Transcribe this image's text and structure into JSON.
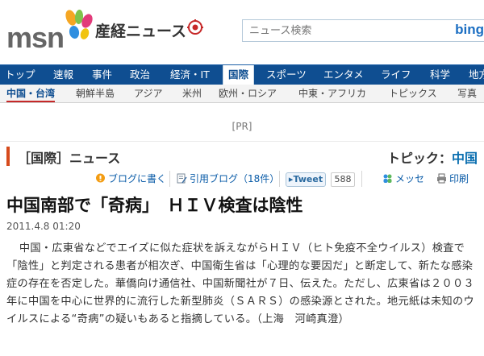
{
  "header": {
    "logo_text": "msn",
    "site_name": "産経ニュース",
    "search_placeholder": "ニュース検索",
    "search_brand": "bing"
  },
  "nav": {
    "items": [
      "トップ",
      "速報",
      "事件",
      "政治",
      "経済・IT",
      "国際",
      "スポーツ",
      "エンタメ",
      "ライフ",
      "科学",
      "地方"
    ],
    "active": "国際"
  },
  "subnav": {
    "items": [
      "中国・台湾",
      "朝鮮半島",
      "アジア",
      "米州",
      "欧州・ロシア",
      "中東・アフリカ",
      "トピックス",
      "写真"
    ],
    "active": "中国・台湾"
  },
  "pr_label": "[PR]",
  "section": {
    "title": "［国際］ニュース",
    "topic_label": "トピック：",
    "topic_value": "中国"
  },
  "toolbar": {
    "blog_write": "ブログに書く",
    "quote_blog": "引用ブログ（18件）",
    "tweet_label": "Tweet",
    "tweet_count": "588",
    "messe": "メッセ",
    "print": "印刷"
  },
  "article": {
    "title": "中国南部で「奇病」　ＨＩＶ検査は陰性",
    "date": "2011.4.8 01:20",
    "body": "中国・広東省などでエイズに似た症状を訴えながらＨＩＶ（ヒト免疫不全ウイルス）検査で「陰性」と判定される患者が相次ぎ、中国衛生省は「心理的な要因だ」と断定して、新たな感染症の存在を否定した。華僑向け通信社、中国新聞社が７日、伝えた。ただし、広東省は２００３年に中国を中心に世界的に流行した新型肺炎（ＳＡＲＳ）の感染源とされた。地元紙は未知のウイルスによる“奇病”の疑いもあると指摘している。（上海　河崎真澄）"
  },
  "colors": {
    "nav_bg": "#0f4e91",
    "accent_red": "#d64a1c",
    "link_blue": "#0b5ca8"
  }
}
